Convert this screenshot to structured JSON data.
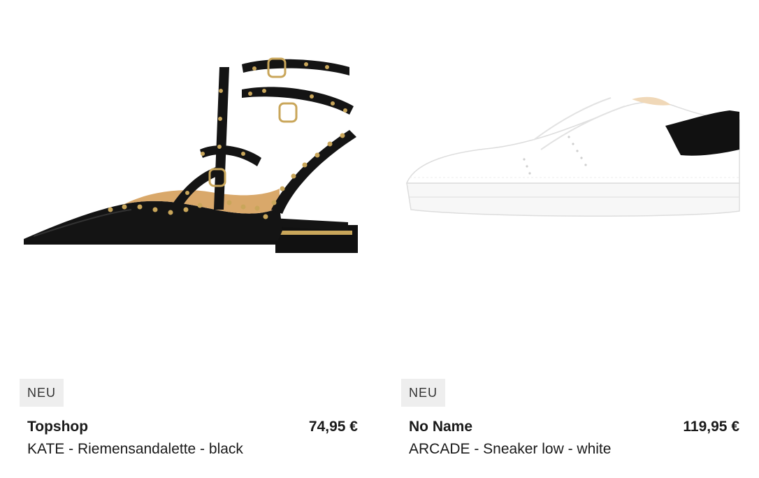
{
  "products": [
    {
      "badge": "NEU",
      "brand": "Topshop",
      "title": "KATE - Riemensandalette - black",
      "price": "74,95 €",
      "image_icon": "strappy-sandal-image"
    },
    {
      "badge": "NEU",
      "brand": "No Name",
      "title": "ARCADE - Sneaker low - white",
      "price": "119,95 €",
      "image_icon": "white-sneaker-image"
    }
  ],
  "colors": {
    "badge_bg": "#eeeeee",
    "text": "#1a1a1a",
    "sandal": "#111111",
    "stud": "#c9a65a",
    "sneaker": "#ffffff"
  }
}
